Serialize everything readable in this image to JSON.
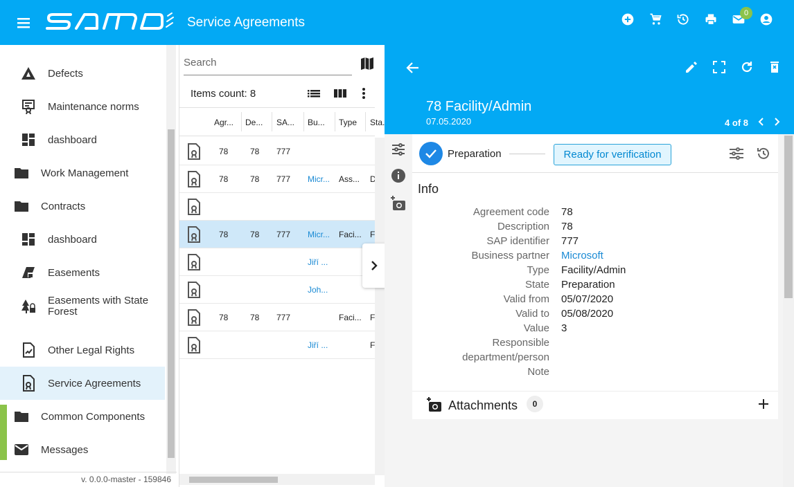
{
  "app": {
    "title": "Service Agreements",
    "logo_text": "samo"
  },
  "topbar": {
    "mail_badge": "0"
  },
  "sidebar": {
    "items": [
      {
        "label": "Defects",
        "icon": "warning-triangle-icon"
      },
      {
        "label": "Maintenance norms",
        "icon": "certificate-icon"
      },
      {
        "label": "dashboard",
        "icon": "dashboard-icon"
      },
      {
        "label": "Work Management",
        "icon": "folder-icon"
      },
      {
        "label": "Contracts",
        "icon": "folder-icon"
      },
      {
        "label": "dashboard",
        "icon": "dashboard-icon"
      },
      {
        "label": "Easements",
        "icon": "easement-icon"
      },
      {
        "label": "Easements with State Forest",
        "icon": "forest-icon"
      },
      {
        "label": "Other Legal Rights",
        "icon": "document-chart-icon"
      },
      {
        "label": "Service Agreements",
        "icon": "service-agreement-icon"
      },
      {
        "label": "Common Components",
        "icon": "folder-icon"
      },
      {
        "label": "Messages",
        "icon": "mail-icon"
      }
    ],
    "version": "v. 0.0.0-master - 159846"
  },
  "list": {
    "search_placeholder": "Search",
    "count_label": "Items count: 8",
    "columns": [
      "Agr...",
      "De...",
      "SA...",
      "Bu...",
      "Type",
      "Sta..."
    ],
    "rows": [
      {
        "agr": "78",
        "de": "78",
        "sa": "777",
        "bu": "",
        "type": "",
        "sta": ""
      },
      {
        "agr": "78",
        "de": "78",
        "sa": "777",
        "bu": "Micr...",
        "type": "Ass...",
        "sta": "D"
      },
      {
        "agr": "",
        "de": "",
        "sa": "",
        "bu": "",
        "type": "",
        "sta": ""
      },
      {
        "agr": "78",
        "de": "78",
        "sa": "777",
        "bu": "Micr...",
        "type": "Faci...",
        "sta": "F"
      },
      {
        "agr": "",
        "de": "",
        "sa": "",
        "bu": "Jiří ...",
        "type": "",
        "sta": ""
      },
      {
        "agr": "",
        "de": "",
        "sa": "",
        "bu": "Joh...",
        "type": "",
        "sta": ""
      },
      {
        "agr": "78",
        "de": "78",
        "sa": "777",
        "bu": "",
        "type": "Faci...",
        "sta": "F"
      },
      {
        "agr": "",
        "de": "",
        "sa": "",
        "bu": "Jiří ...",
        "type": "",
        "sta": "F"
      }
    ]
  },
  "detail": {
    "title": "78 Facility/Admin",
    "date": "07.05.2020",
    "pager": "4 of 8",
    "state_current": "Preparation",
    "state_next": "Ready for verification",
    "info_heading": "Info",
    "fields": [
      {
        "key": "Agreement code",
        "value": "78"
      },
      {
        "key": "Description",
        "value": "78"
      },
      {
        "key": "SAP identifier",
        "value": "777"
      },
      {
        "key": "Business partner",
        "value": "Microsoft"
      },
      {
        "key": "Type",
        "value": "Facility/Admin"
      },
      {
        "key": "State",
        "value": "Preparation"
      },
      {
        "key": "Valid from",
        "value": "05/07/2020"
      },
      {
        "key": "Valid to",
        "value": "05/08/2020"
      },
      {
        "key": "Value",
        "value": "3"
      },
      {
        "key": "Responsible",
        "value": ""
      },
      {
        "key": "department/person",
        "value": ""
      },
      {
        "key": "Note",
        "value": ""
      }
    ],
    "attachments_label": "Attachments",
    "attachments_count": "0"
  },
  "colors": {
    "primary": "#03a9f4",
    "accent": "#8bc34a",
    "link": "#1a8ad4"
  }
}
